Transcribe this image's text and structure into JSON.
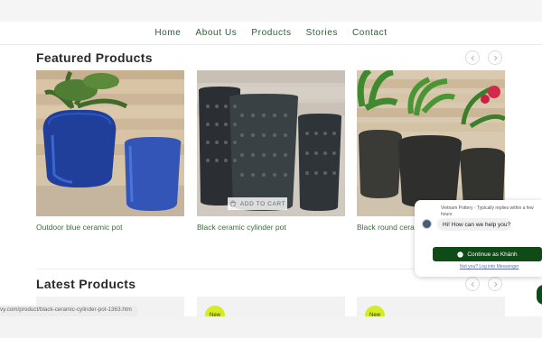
{
  "nav": {
    "items": [
      "Home",
      "About Us",
      "Products",
      "Stories",
      "Contact"
    ]
  },
  "featured": {
    "title": "Featured Products",
    "products": [
      {
        "name": "Outdoor blue ceramic pot"
      },
      {
        "name": "Black ceramic cylinder pot",
        "add_to_cart": "ADD TO CART"
      },
      {
        "name": "Black round ceramic pot"
      }
    ]
  },
  "latest": {
    "title": "Latest Products",
    "badge": "New"
  },
  "status_url": "vy.com/product/black-ceramic-cylinder-pot-1363.htm",
  "chat": {
    "header": "Vietnam Pottery · Typically replies within a few hours",
    "greeting": "Hi! How can we help you?",
    "continue_label": "Continue as Khánh",
    "not_you": "Not you? Log into Messenger"
  },
  "colors": {
    "accent": "#2e5a36",
    "chat_button": "#0f4b16",
    "badge": "#d4ec25"
  },
  "icons": [
    "chevron-left-icon",
    "chevron-right-icon",
    "cart-icon",
    "messenger-icon"
  ]
}
